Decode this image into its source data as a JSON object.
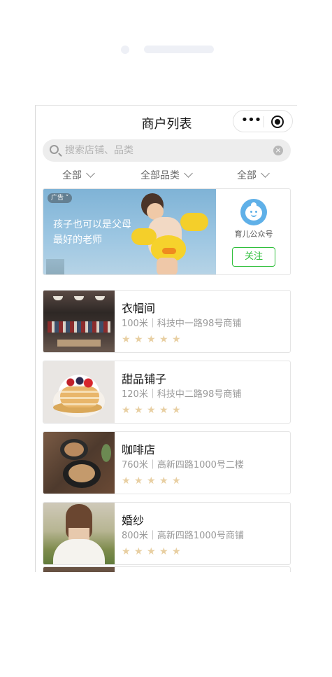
{
  "nav": {
    "title": "商户列表",
    "more_icon": "more-dots-icon",
    "close_icon": "target-circle-icon"
  },
  "search": {
    "placeholder": "搜索店铺、品类"
  },
  "filters": [
    {
      "label": "全部"
    },
    {
      "label": "全部品类"
    },
    {
      "label": "全部"
    }
  ],
  "ad": {
    "tag": "广告",
    "line1": "孩子也可以是父母",
    "line2": "最好的老师",
    "account_name": "育儿公众号",
    "follow_label": "关注"
  },
  "stores": [
    {
      "name": "衣帽间",
      "address": "100米｜科技中一路98号商铺",
      "rating": 5
    },
    {
      "name": "甜品铺子",
      "address": "120米｜科技中二路98号商铺",
      "rating": 5
    },
    {
      "name": "咖啡店",
      "address": "760米｜高新四路1000号二楼",
      "rating": 5
    },
    {
      "name": "婚纱",
      "address": "800米｜高新四路1000号商铺",
      "rating": 5
    }
  ],
  "colors": {
    "accent_green": "#2fbf3b",
    "star": "#e8cfa2",
    "search_bg": "#ededed"
  }
}
